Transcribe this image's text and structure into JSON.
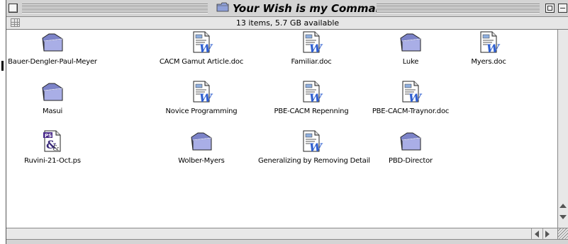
{
  "window": {
    "title": "Your Wish is my Command",
    "status": "13 items, 5.7 GB available"
  },
  "items": [
    {
      "label": "Bauer-Dengler-Paul-Meyer",
      "kind": "folder"
    },
    {
      "label": "CACM Gamut Article.doc",
      "kind": "word-doc"
    },
    {
      "label": "Familiar.doc",
      "kind": "word-doc"
    },
    {
      "label": "Luke",
      "kind": "folder"
    },
    {
      "label": "Myers.doc",
      "kind": "word-doc"
    },
    {
      "label": "Masui",
      "kind": "folder"
    },
    {
      "label": "Novice Programming",
      "kind": "word-doc"
    },
    {
      "label": "PBE-CACM Repenning",
      "kind": "word-doc"
    },
    {
      "label": "PBE-CACM-Traynor.doc",
      "kind": "word-doc"
    },
    {
      "label": "Ruvini-21-Oct.ps",
      "kind": "postscript"
    },
    {
      "label": "Wolber-Myers",
      "kind": "folder"
    },
    {
      "label": "Generalizing by Removing Detail",
      "kind": "word-doc"
    },
    {
      "label": "PBD-Director",
      "kind": "folder"
    }
  ],
  "colors": {
    "folder": "#9a9ed8",
    "word_w": "#2f5fd0",
    "ps_badge": "#4a2a8a"
  }
}
